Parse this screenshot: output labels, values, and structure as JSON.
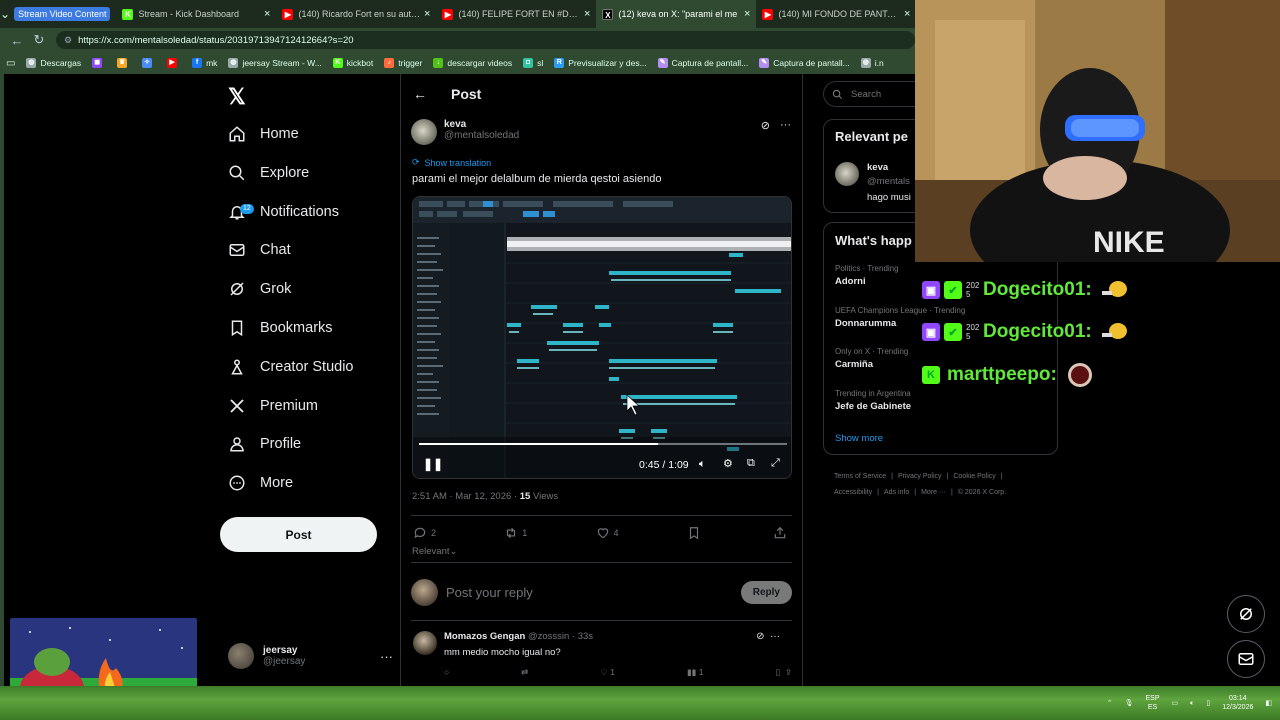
{
  "browser": {
    "group_chip": "Stream Video Content",
    "tabs": [
      {
        "title": "Stream - Kick Dashboard",
        "icon": "kick-icon",
        "color": "#53fc18"
      },
      {
        "title": "(140) Ricardo Fort en su auto habl",
        "icon": "youtube-icon",
        "color": "#ff0000"
      },
      {
        "title": "(140) FELIPE FORT EN #DESENCRI",
        "icon": "youtube-icon",
        "color": "#ff0000"
      },
      {
        "title": "(12) keva on X: \"parami el me",
        "icon": "x-icon",
        "color": "#000000"
      },
      {
        "title": "(140) MI FONDO DE PANTALLA - Y",
        "icon": "youtube-icon",
        "color": "#ff0000"
      }
    ],
    "url": "https://x.com/mentalsoledad/status/2031971394712412664?s=20",
    "bookmarks": [
      {
        "label": "Descargas",
        "icon": "globe-icon",
        "color": "#9aa"
      },
      {
        "label": "",
        "icon": "twitch-icon",
        "color": "#9146ff"
      },
      {
        "label": "",
        "icon": "crown-icon",
        "color": "#f5a623"
      },
      {
        "label": "",
        "icon": "discord-icon",
        "color": "#4a8cf7"
      },
      {
        "label": "",
        "icon": "youtube-icon",
        "color": "#ff0000"
      },
      {
        "label": "mk",
        "icon": "facebook-icon",
        "color": "#1877f2"
      },
      {
        "label": "jeersay Stream - W...",
        "icon": "globe-icon",
        "color": "#9aa"
      },
      {
        "label": "kickbot",
        "icon": "kick-icon",
        "color": "#53fc18"
      },
      {
        "label": "trigger",
        "icon": "bell-icon",
        "color": "#ff6b3d"
      },
      {
        "label": "descargar videos",
        "icon": "download-icon",
        "color": "#53c218"
      },
      {
        "label": "sl",
        "icon": "streamlabs-icon",
        "color": "#31c3a2"
      },
      {
        "label": "Previsualizar y des...",
        "icon": "preview-icon",
        "color": "#2b9cf2"
      },
      {
        "label": "Captura de pantall...",
        "icon": "feather-icon",
        "color": "#b48ef0"
      },
      {
        "label": "Captura de pantall...",
        "icon": "feather-icon",
        "color": "#b48ef0"
      },
      {
        "label": "i.n",
        "icon": "globe-icon",
        "color": "#9aa"
      }
    ]
  },
  "nav": {
    "items": [
      {
        "label": "Home",
        "icon": "home-icon"
      },
      {
        "label": "Explore",
        "icon": "search-icon"
      },
      {
        "label": "Notifications",
        "icon": "bell-icon"
      },
      {
        "label": "Chat",
        "icon": "mail-icon"
      },
      {
        "label": "Grok",
        "icon": "grok-icon"
      },
      {
        "label": "Bookmarks",
        "icon": "bookmark-icon"
      },
      {
        "label": "Creator Studio",
        "icon": "creator-icon"
      },
      {
        "label": "Premium",
        "icon": "x-icon"
      },
      {
        "label": "Profile",
        "icon": "person-icon"
      },
      {
        "label": "More",
        "icon": "more-circle-icon"
      }
    ],
    "notif_badge": "12",
    "post_button": "Post",
    "account": {
      "name": "jeersay",
      "handle": "@jeersay"
    }
  },
  "post": {
    "header_title": "Post",
    "author_name": "keva",
    "author_handle": "@mentalsoledad",
    "show_translation": "Show translation",
    "text": "parami el mejor delalbum de mierda qestoi asiendo",
    "video_time": "0:45 / 1:09",
    "video_progress": 0.65,
    "timestamp": "2:51 AM · Mar 12, 2026 · ",
    "views_count": "15",
    "views_label": " Views",
    "replies": "2",
    "reposts": "1",
    "likes": "4",
    "sort_label": "Relevant",
    "reply_placeholder": "Post your reply",
    "reply_button": "Reply"
  },
  "comment": {
    "name": "Momazos Gengan",
    "handle_time": "@zosssin · 33s",
    "text": "mm medio mocho igual no?",
    "likes": "1"
  },
  "right": {
    "search_placeholder": "Search",
    "relevant_title": "Relevant pe",
    "relevant_name": "keva",
    "relevant_handle": "@mentals",
    "relevant_bio": "hago musi",
    "happening_title": "What's happ",
    "trends": [
      {
        "context": "Politics · Trending",
        "title": "Adorni"
      },
      {
        "context": "UEFA Champions League · Trending",
        "title": "Donnarumma"
      },
      {
        "context": "Only on X · Trending",
        "title": "Carmiña"
      },
      {
        "context": "Trending in Argentina",
        "title": "Jefe de Gabinete"
      }
    ],
    "show_more": "Show more",
    "footer": [
      "Terms of Service",
      "|",
      "Privacy Policy",
      "|",
      "Cookie Policy",
      "|",
      "Accessibility",
      "|",
      "Ads info",
      "|",
      "More ···",
      "|",
      "© 2026 X Corp."
    ]
  },
  "chat": [
    {
      "user": "Dogecito01:",
      "badge_colors": [
        "#9146ff",
        "#53fc18"
      ],
      "badge_text": "2025"
    },
    {
      "user": "Dogecito01:",
      "badge_colors": [
        "#9146ff",
        "#53fc18"
      ],
      "badge_text": "2025"
    },
    {
      "user": "marttpeepo:",
      "badge_colors": [
        "#53fc18"
      ],
      "badge_text": ""
    }
  ],
  "taskbar": {
    "lang_top": "ESP",
    "lang_bottom": "ES",
    "time": "03:14",
    "date": "12/3/2026"
  },
  "colors": {
    "accent": "#1d9bf0",
    "chat_name": "#62e83a",
    "browser_frame": "#2f4a31"
  }
}
